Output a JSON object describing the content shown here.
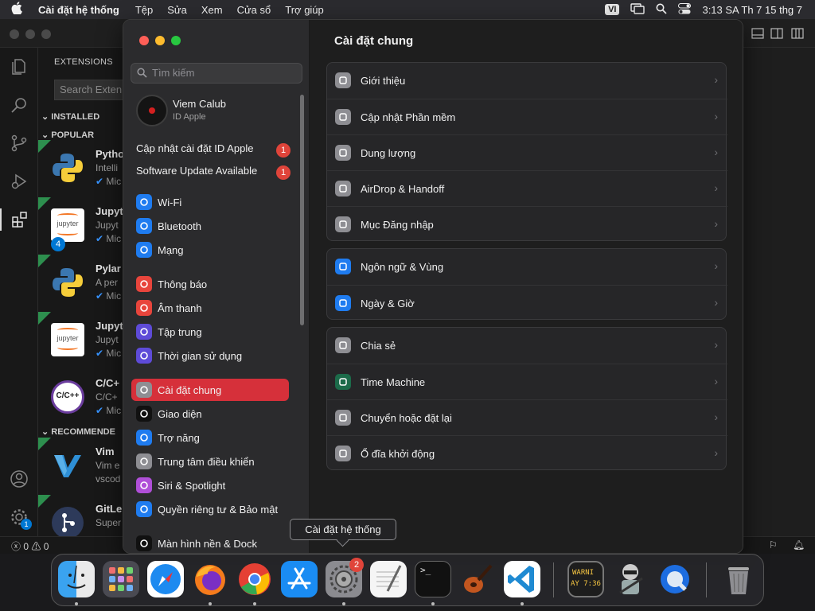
{
  "menubar": {
    "app_name": "Cài đặt hệ thống",
    "menus": [
      "Tệp",
      "Sửa",
      "Xem",
      "Cửa sổ",
      "Trợ giúp"
    ],
    "input_source": "VI",
    "clock": "3:13 SA Th 7 15 thg 7"
  },
  "vscode": {
    "extensions_title": "EXTENSIONS",
    "search_placeholder": "Search Exten",
    "installed_label": "INSTALLED",
    "popular_label": "POPULAR",
    "recommended_label": "RECOMMENDE",
    "extensions": [
      {
        "name": "Pytho",
        "desc": "Intelli",
        "publisher": "Mic"
      },
      {
        "name": "Jupyt",
        "desc": "Jupyt",
        "publisher": "Mic",
        "badge": "4"
      },
      {
        "name": "Pylar",
        "desc": "A per",
        "publisher": "Mic"
      },
      {
        "name": "Jupyt",
        "desc": "Jupyt",
        "publisher": "Mic"
      },
      {
        "name": "C/C+",
        "desc": "C/C+",
        "publisher": "Mic"
      },
      {
        "name": "Vim",
        "desc": "Vim e",
        "publisher": "vscod"
      },
      {
        "name": "GitLe",
        "desc": "Super",
        "publisher": ""
      }
    ],
    "jupyter_logo": "jupyter",
    "cpp_logo": "C/C++",
    "status_errors": "0",
    "status_warnings": "0",
    "settings_badge": "1"
  },
  "settings": {
    "search_placeholder": "Tìm kiếm",
    "account_name": "Viem Calub",
    "account_sub": "ID Apple",
    "notifications": [
      {
        "label": "Cập nhật cài đặt ID Apple",
        "count": "1"
      },
      {
        "label": "Software Update Available",
        "count": "1"
      }
    ],
    "sidebar": [
      {
        "label": "Wi-Fi",
        "icon": "wifi-icon",
        "color": "#1f7cf0"
      },
      {
        "label": "Bluetooth",
        "icon": "bluetooth-icon",
        "color": "#1f7cf0"
      },
      {
        "label": "Mạng",
        "icon": "globe-icon",
        "color": "#1f7cf0"
      },
      {
        "label": "Thông báo",
        "icon": "bell-icon",
        "color": "#e8453c"
      },
      {
        "label": "Âm thanh",
        "icon": "speaker-icon",
        "color": "#e8453c"
      },
      {
        "label": "Tập trung",
        "icon": "moon-icon",
        "color": "#5e4bd8"
      },
      {
        "label": "Thời gian sử dụng",
        "icon": "hourglass-icon",
        "color": "#5e4bd8"
      },
      {
        "label": "Cài đặt chung",
        "icon": "gear-icon",
        "color": "#8e8e93"
      },
      {
        "label": "Giao diện",
        "icon": "appearance-icon",
        "color": "#111111"
      },
      {
        "label": "Trợ năng",
        "icon": "accessibility-icon",
        "color": "#1f7cf0"
      },
      {
        "label": "Trung tâm điều khiển",
        "icon": "control-center-icon",
        "color": "#8e8e93"
      },
      {
        "label": "Siri & Spotlight",
        "icon": "siri-icon",
        "color": "#b04fd8"
      },
      {
        "label": "Quyền riêng tư & Bảo mật",
        "icon": "hand-icon",
        "color": "#1f7cf0"
      },
      {
        "label": "Màn hình nền & Dock",
        "icon": "dock-icon",
        "color": "#111111"
      }
    ],
    "selected_index": 7,
    "main_title": "Cài đặt chung",
    "groups": [
      [
        {
          "label": "Giới thiệu",
          "icon": "laptop-icon",
          "color": "#8e8e93"
        },
        {
          "label": "Cập nhật Phần mềm",
          "icon": "gear-icon",
          "color": "#8e8e93"
        },
        {
          "label": "Dung lượng",
          "icon": "drive-icon",
          "color": "#8e8e93"
        },
        {
          "label": "AirDrop & Handoff",
          "icon": "airdrop-icon",
          "color": "#8e8e93"
        },
        {
          "label": "Mục Đăng nhập",
          "icon": "list-icon",
          "color": "#8e8e93"
        }
      ],
      [
        {
          "label": "Ngôn ngữ & Vùng",
          "icon": "globe-icon",
          "color": "#1f7cf0"
        },
        {
          "label": "Ngày & Giờ",
          "icon": "calendar-icon",
          "color": "#1f7cf0"
        }
      ],
      [
        {
          "label": "Chia sẻ",
          "icon": "share-icon",
          "color": "#8e8e93"
        },
        {
          "label": "Time Machine",
          "icon": "time-machine-icon",
          "color": "#1c6b4a"
        },
        {
          "label": "Chuyển hoặc đặt lại",
          "icon": "reset-icon",
          "color": "#8e8e93"
        },
        {
          "label": "Ổ đĩa khởi động",
          "icon": "startup-disk-icon",
          "color": "#8e8e93"
        }
      ]
    ],
    "chevron": "›"
  },
  "dock": {
    "tooltip": "Cài đặt hệ thống",
    "settings_badge": "2",
    "console_text_1": "WARNI",
    "console_text_2": "AY 7:36",
    "terminal_prompt": ">_"
  }
}
